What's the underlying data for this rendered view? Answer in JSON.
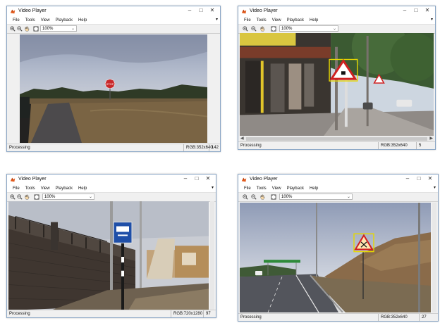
{
  "windows": [
    {
      "title": "Video Player",
      "menu": [
        "File",
        "Tools",
        "View",
        "Playback",
        "Help"
      ],
      "zoom": "100%",
      "status": "Processing",
      "resolution": "RGB:352x640",
      "frame": "142"
    },
    {
      "title": "Video Player",
      "menu": [
        "File",
        "Tools",
        "View",
        "Playback",
        "Help"
      ],
      "zoom": "100%",
      "status": "Processing",
      "resolution": "RGB:352x640",
      "frame": "5"
    },
    {
      "title": "Video Player",
      "menu": [
        "File",
        "Tools",
        "View",
        "Playback",
        "Help"
      ],
      "zoom": "100%",
      "status": "Processing",
      "resolution": "RGB:720x1280",
      "frame": "97"
    },
    {
      "title": "Video Player",
      "menu": [
        "File",
        "Tools",
        "View",
        "Playback",
        "Help"
      ],
      "zoom": "100%",
      "status": "Processing",
      "resolution": "RGB:352x640",
      "frame": "27"
    }
  ],
  "icons": [
    "matlab-app-icon",
    "zoom-in-icon",
    "zoom-out-icon",
    "pan-hand-icon",
    "fit-to-window-icon",
    "minimize-icon",
    "maximize-icon",
    "close-icon",
    "menu-expand-icon"
  ],
  "colors": {
    "window_border": "#8aa6c6",
    "window_bg": "#f0f0f0",
    "detection_box": "#e6d800",
    "stop_sign": "#c8282a",
    "warning_sign_red": "#d02020",
    "info_sign_blue": "#1f4fa8"
  }
}
